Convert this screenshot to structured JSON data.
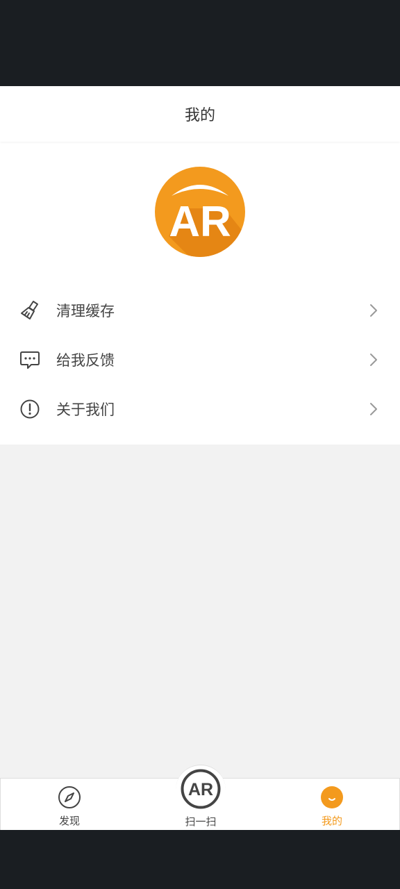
{
  "header": {
    "title": "我的"
  },
  "profile": {
    "avatar_icon": "ar-logo-icon",
    "avatar_text": "AR",
    "colors": {
      "avatar_orange": "#f39a1e",
      "avatar_shadow": "#e07f12"
    }
  },
  "menu": {
    "items": [
      {
        "label": "清理缓存",
        "icon": "brush-icon"
      },
      {
        "label": "给我反馈",
        "icon": "chat-bubble-icon"
      },
      {
        "label": "关于我们",
        "icon": "info-circle-icon"
      }
    ]
  },
  "tabbar": {
    "tabs": [
      {
        "label": "发现",
        "icon": "compass-icon",
        "active": false
      },
      {
        "label": "扫一扫",
        "icon": "ar-scan-icon",
        "icon_text": "AR",
        "active": false
      },
      {
        "label": "我的",
        "icon": "smile-face-icon",
        "active": true
      }
    ],
    "colors": {
      "active": "#f39a1e",
      "inactive": "#444444"
    }
  }
}
